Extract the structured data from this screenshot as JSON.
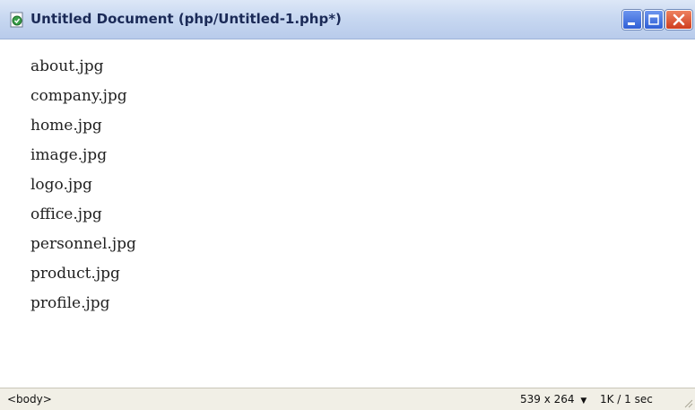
{
  "window": {
    "title": "Untitled Document (php/Untitled-1.php*)",
    "icons": {
      "app": "document-icon",
      "minimize": "minimize-icon",
      "maximize": "maximize-icon",
      "close": "close-icon"
    },
    "colors": {
      "titlebar": "#c8d8f1",
      "title_text": "#1b2a57",
      "close_button": "#cf3d1e",
      "min_max_button": "#2f5fd6"
    }
  },
  "files": [
    "about.jpg",
    "company.jpg",
    "home.jpg",
    "image.jpg",
    "logo.jpg",
    "office.jpg",
    "personnel.jpg",
    "product.jpg",
    "profile.jpg"
  ],
  "statusbar": {
    "tag": "<body>",
    "window_size": "539 x 264",
    "download": "1K / 1 sec"
  }
}
